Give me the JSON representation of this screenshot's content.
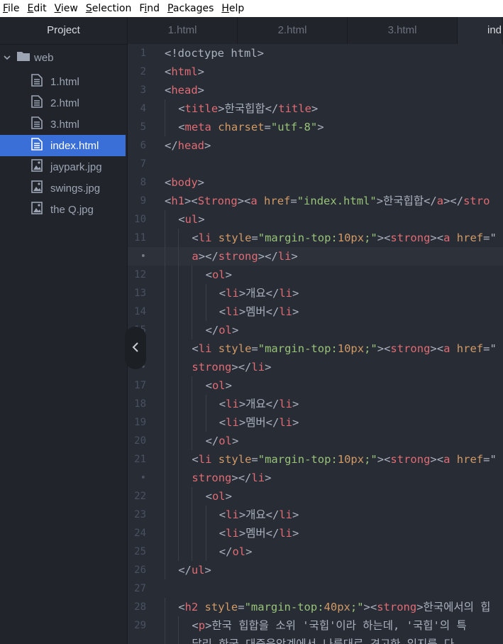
{
  "menu": [
    "File",
    "Edit",
    "View",
    "Selection",
    "Find",
    "Packages",
    "Help"
  ],
  "menu_mnemonics": [
    "F",
    "E",
    "V",
    "S",
    "i",
    "P",
    "H"
  ],
  "sidebar": {
    "title": "Project",
    "folder": "web",
    "files": [
      {
        "name": "1.html",
        "icon": "file-text-icon",
        "selected": false
      },
      {
        "name": "2.html",
        "icon": "file-text-icon",
        "selected": false
      },
      {
        "name": "3.html",
        "icon": "file-text-icon",
        "selected": false
      },
      {
        "name": "index.html",
        "icon": "file-text-icon",
        "selected": true
      },
      {
        "name": "jaypark.jpg",
        "icon": "file-image-icon",
        "selected": false
      },
      {
        "name": "swings.jpg",
        "icon": "file-image-icon",
        "selected": false
      },
      {
        "name": "the Q.jpg",
        "icon": "file-image-icon",
        "selected": false
      }
    ]
  },
  "tabs": [
    "1.html",
    "2.html",
    "3.html",
    "inde"
  ],
  "active_tab": 3,
  "theme": {
    "accent": "#3a6fd8",
    "tag": "#e06c75",
    "attr": "#d19a66",
    "string": "#98c379",
    "text": "#abb2bf"
  },
  "editor": {
    "lines": [
      {
        "n": "1",
        "i": 0,
        "tokens": [
          [
            "p",
            "<!doctype html>"
          ]
        ]
      },
      {
        "n": "2",
        "i": 0,
        "tokens": [
          [
            "p",
            "<"
          ],
          [
            "t",
            "html"
          ],
          [
            "p",
            ">"
          ]
        ]
      },
      {
        "n": "3",
        "i": 0,
        "tokens": [
          [
            "p",
            "<"
          ],
          [
            "t",
            "head"
          ],
          [
            "p",
            ">"
          ]
        ]
      },
      {
        "n": "4",
        "i": 1,
        "tokens": [
          [
            "p",
            "<"
          ],
          [
            "t",
            "title"
          ],
          [
            "p",
            ">한국힙합</"
          ],
          [
            "t",
            "title"
          ],
          [
            "p",
            ">"
          ]
        ]
      },
      {
        "n": "5",
        "i": 1,
        "tokens": [
          [
            "p",
            "<"
          ],
          [
            "t",
            "meta"
          ],
          [
            "p",
            " "
          ],
          [
            "a",
            "charset"
          ],
          [
            "p",
            "="
          ],
          [
            "s",
            "\"utf-8\""
          ],
          [
            "p",
            ">"
          ]
        ]
      },
      {
        "n": "6",
        "i": 0,
        "tokens": [
          [
            "p",
            "</"
          ],
          [
            "t",
            "head"
          ],
          [
            "p",
            ">"
          ]
        ]
      },
      {
        "n": "7",
        "i": 0,
        "tokens": []
      },
      {
        "n": "8",
        "i": 0,
        "tokens": [
          [
            "p",
            "<"
          ],
          [
            "t",
            "body"
          ],
          [
            "p",
            ">"
          ]
        ]
      },
      {
        "n": "9",
        "i": 0,
        "tokens": [
          [
            "p",
            "<"
          ],
          [
            "t",
            "h1"
          ],
          [
            "p",
            "><"
          ],
          [
            "t",
            "Strong"
          ],
          [
            "p",
            "><"
          ],
          [
            "t",
            "a"
          ],
          [
            "p",
            " "
          ],
          [
            "a",
            "href"
          ],
          [
            "p",
            "="
          ],
          [
            "s",
            "\"index.html\""
          ],
          [
            "p",
            ">한국힙합</"
          ],
          [
            "t",
            "a"
          ],
          [
            "p",
            "></"
          ],
          [
            "t",
            "stro"
          ]
        ]
      },
      {
        "n": "10",
        "i": 1,
        "tokens": [
          [
            "p",
            "<"
          ],
          [
            "t",
            "ul"
          ],
          [
            "p",
            ">"
          ]
        ]
      },
      {
        "n": "11",
        "i": 2,
        "tokens": [
          [
            "p",
            "<"
          ],
          [
            "t",
            "li"
          ],
          [
            "p",
            " "
          ],
          [
            "a",
            "style"
          ],
          [
            "p",
            "="
          ],
          [
            "s",
            "\"margin-top:"
          ],
          [
            "n",
            "10px"
          ],
          [
            "s",
            ";\""
          ],
          [
            "p",
            "><"
          ],
          [
            "t",
            "strong"
          ],
          [
            "p",
            "><"
          ],
          [
            "t",
            "a"
          ],
          [
            "p",
            " "
          ],
          [
            "a",
            "href"
          ],
          [
            "p",
            "=\""
          ]
        ]
      },
      {
        "n": "•",
        "i": 2,
        "cur": true,
        "tokens": [
          [
            "t",
            "a"
          ],
          [
            "p",
            "></"
          ],
          [
            "t",
            "strong"
          ],
          [
            "p",
            "></"
          ],
          [
            "t",
            "li"
          ],
          [
            "p",
            ">"
          ]
        ]
      },
      {
        "n": "12",
        "i": 3,
        "tokens": [
          [
            "p",
            "<"
          ],
          [
            "t",
            "ol"
          ],
          [
            "p",
            ">"
          ]
        ]
      },
      {
        "n": "13",
        "i": 4,
        "tokens": [
          [
            "p",
            "<"
          ],
          [
            "t",
            "li"
          ],
          [
            "p",
            ">개요</"
          ],
          [
            "t",
            "li"
          ],
          [
            "p",
            ">"
          ]
        ]
      },
      {
        "n": "14",
        "i": 4,
        "tokens": [
          [
            "p",
            "<"
          ],
          [
            "t",
            "li"
          ],
          [
            "p",
            ">멤버</"
          ],
          [
            "t",
            "li"
          ],
          [
            "p",
            ">"
          ]
        ]
      },
      {
        "n": "15",
        "i": 3,
        "tokens": [
          [
            "p",
            "</"
          ],
          [
            "t",
            "ol"
          ],
          [
            "p",
            ">"
          ]
        ]
      },
      {
        "n": "16",
        "i": 2,
        "tokens": [
          [
            "p",
            "<"
          ],
          [
            "t",
            "li"
          ],
          [
            "p",
            " "
          ],
          [
            "a",
            "style"
          ],
          [
            "p",
            "="
          ],
          [
            "s",
            "\"margin-top:"
          ],
          [
            "n",
            "10px"
          ],
          [
            "s",
            ";\""
          ],
          [
            "p",
            "><"
          ],
          [
            "t",
            "strong"
          ],
          [
            "p",
            "><"
          ],
          [
            "t",
            "a"
          ],
          [
            "p",
            " "
          ],
          [
            "a",
            "href"
          ],
          [
            "p",
            "=\""
          ]
        ]
      },
      {
        "n": "•",
        "i": 2,
        "tokens": [
          [
            "t",
            "strong"
          ],
          [
            "p",
            "></"
          ],
          [
            "t",
            "li"
          ],
          [
            "p",
            ">"
          ]
        ]
      },
      {
        "n": "17",
        "i": 3,
        "tokens": [
          [
            "p",
            "<"
          ],
          [
            "t",
            "ol"
          ],
          [
            "p",
            ">"
          ]
        ]
      },
      {
        "n": "18",
        "i": 4,
        "tokens": [
          [
            "p",
            "<"
          ],
          [
            "t",
            "li"
          ],
          [
            "p",
            ">개요</"
          ],
          [
            "t",
            "li"
          ],
          [
            "p",
            ">"
          ]
        ]
      },
      {
        "n": "19",
        "i": 4,
        "tokens": [
          [
            "p",
            "<"
          ],
          [
            "t",
            "li"
          ],
          [
            "p",
            ">멤버</"
          ],
          [
            "t",
            "li"
          ],
          [
            "p",
            ">"
          ]
        ]
      },
      {
        "n": "20",
        "i": 3,
        "tokens": [
          [
            "p",
            "</"
          ],
          [
            "t",
            "ol"
          ],
          [
            "p",
            ">"
          ]
        ]
      },
      {
        "n": "21",
        "i": 2,
        "tokens": [
          [
            "p",
            "<"
          ],
          [
            "t",
            "li"
          ],
          [
            "p",
            " "
          ],
          [
            "a",
            "style"
          ],
          [
            "p",
            "="
          ],
          [
            "s",
            "\"margin-top:"
          ],
          [
            "n",
            "10px"
          ],
          [
            "s",
            ";\""
          ],
          [
            "p",
            "><"
          ],
          [
            "t",
            "strong"
          ],
          [
            "p",
            "><"
          ],
          [
            "t",
            "a"
          ],
          [
            "p",
            " "
          ],
          [
            "a",
            "href"
          ],
          [
            "p",
            "=\""
          ]
        ]
      },
      {
        "n": "•",
        "i": 2,
        "tokens": [
          [
            "t",
            "strong"
          ],
          [
            "p",
            "></"
          ],
          [
            "t",
            "li"
          ],
          [
            "p",
            ">"
          ]
        ]
      },
      {
        "n": "22",
        "i": 3,
        "tokens": [
          [
            "p",
            "<"
          ],
          [
            "t",
            "ol"
          ],
          [
            "p",
            ">"
          ]
        ]
      },
      {
        "n": "23",
        "i": 4,
        "tokens": [
          [
            "p",
            "<"
          ],
          [
            "t",
            "li"
          ],
          [
            "p",
            ">개요</"
          ],
          [
            "t",
            "li"
          ],
          [
            "p",
            ">"
          ]
        ]
      },
      {
        "n": "24",
        "i": 4,
        "tokens": [
          [
            "p",
            "<"
          ],
          [
            "t",
            "li"
          ],
          [
            "p",
            ">멤버</"
          ],
          [
            "t",
            "li"
          ],
          [
            "p",
            ">"
          ]
        ]
      },
      {
        "n": "25",
        "i": 4,
        "tokens": [
          [
            "p",
            "</"
          ],
          [
            "t",
            "ol"
          ],
          [
            "p",
            ">"
          ]
        ]
      },
      {
        "n": "26",
        "i": 1,
        "tokens": [
          [
            "p",
            "</"
          ],
          [
            "t",
            "ul"
          ],
          [
            "p",
            ">"
          ]
        ]
      },
      {
        "n": "27",
        "i": 0,
        "tokens": []
      },
      {
        "n": "28",
        "i": 1,
        "tokens": [
          [
            "p",
            "<"
          ],
          [
            "t",
            "h2"
          ],
          [
            "p",
            " "
          ],
          [
            "a",
            "style"
          ],
          [
            "p",
            "="
          ],
          [
            "s",
            "\"margin-top:"
          ],
          [
            "n",
            "40px"
          ],
          [
            "s",
            ";\""
          ],
          [
            "p",
            "><"
          ],
          [
            "t",
            "strong"
          ],
          [
            "p",
            ">한국에서의 힙"
          ]
        ]
      },
      {
        "n": "29",
        "i": 2,
        "tokens": [
          [
            "p",
            "<"
          ],
          [
            "t",
            "p"
          ],
          [
            "p",
            ">한국 힙합을 소위 '국힙'이라 하는데, '국힙'의 특"
          ]
        ]
      },
      {
        "n": "",
        "i": 2,
        "tokens": [
          [
            "p",
            "달리 한국 대중음악계에서 나름대로 견고한 입지를 다"
          ]
        ]
      }
    ]
  }
}
